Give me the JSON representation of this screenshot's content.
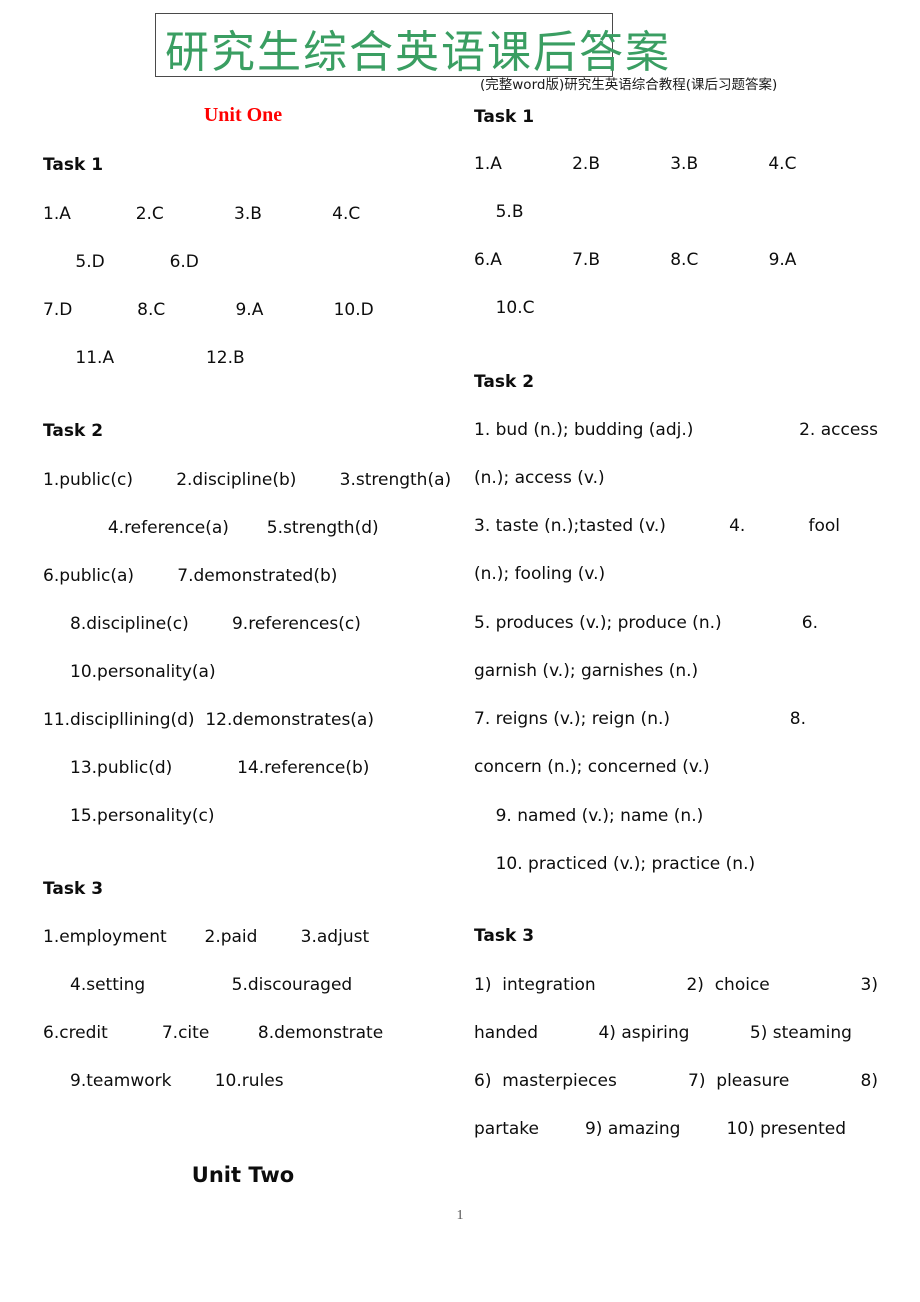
{
  "header": {
    "watermark_title": "研究生综合英语课后答案",
    "watermark_color": "#3a9e62",
    "subtitle": "(完整word版)研究生英语综合教程(课后习题答案)"
  },
  "page_number": "1",
  "left_column": {
    "unit_heading": "Unit One",
    "unit_heading_color": "#ff0000",
    "tasks": [
      {
        "heading": "Task 1",
        "lines": [
          "1.A            2.C             3.B             4.C",
          "      5.D            6.D",
          "7.D            8.C             9.A             10.D",
          "      11.A                 12.B"
        ]
      },
      {
        "heading": "Task 2",
        "lines": [
          "1.public(c)        2.discipline(b)        3.strength(a)",
          "            4.reference(a)       5.strength(d)",
          "6.public(a)        7.demonstrated(b)",
          "     8.discipline(c)        9.references(c)",
          "     10.personality(a)",
          "11.discipllining(d)  12.demonstrates(a)",
          "     13.public(d)            14.reference(b)",
          "     15.personality(c)"
        ]
      },
      {
        "heading": "Task 3",
        "lines": [
          "1.employment       2.paid        3.adjust",
          "     4.setting                5.discouraged",
          "6.credit          7.cite         8.demonstrate",
          "     9.teamwork        10.rules"
        ]
      }
    ],
    "closing_heading": "Unit Two"
  },
  "right_column": {
    "tasks": [
      {
        "heading": "Task 1",
        "lines": [
          "1.A             2.B             3.B             4.C",
          "    5.B",
          "6.A             7.B             8.C             9.A",
          "    10.C"
        ]
      },
      {
        "heading": "Task 2",
        "justified_lines": [
          {
            "left": "1. bud (n.); budding (adj.)",
            "right": "2. access"
          },
          {
            "left": "(n.); access (v.)",
            "right": ""
          },
          {
            "left": "3. taste (n.);tasted (v.)",
            "mid": "4.",
            "right": "fool"
          },
          {
            "left": "(n.); fooling (v.)",
            "right": ""
          },
          {
            "left": "5. produces (v.); produce (n.)",
            "right": "6."
          },
          {
            "left": "garnish (v.); garnishes (n.)",
            "right": ""
          },
          {
            "left": "7. reigns (v.); reign (n.)",
            "right": "8."
          },
          {
            "left": "concern (n.); concerned (v.)",
            "right": ""
          },
          {
            "left": "    9. named (v.); name (n.)",
            "right": ""
          },
          {
            "left": "    10. practiced (v.); practice (n.)",
            "right": ""
          }
        ]
      },
      {
        "heading": "Task 3",
        "justified_lines": [
          {
            "left": "1)  integration",
            "mid": "2)  choice",
            "right": "3)"
          },
          {
            "left": "handed",
            "mid": "4) aspiring",
            "right": "5) steaming"
          },
          {
            "left": "6)  masterpieces",
            "mid": "7)  pleasure",
            "right": "8)"
          },
          {
            "left": "partake",
            "mid": "9) amazing",
            "right": "10) presented"
          }
        ]
      }
    ]
  }
}
